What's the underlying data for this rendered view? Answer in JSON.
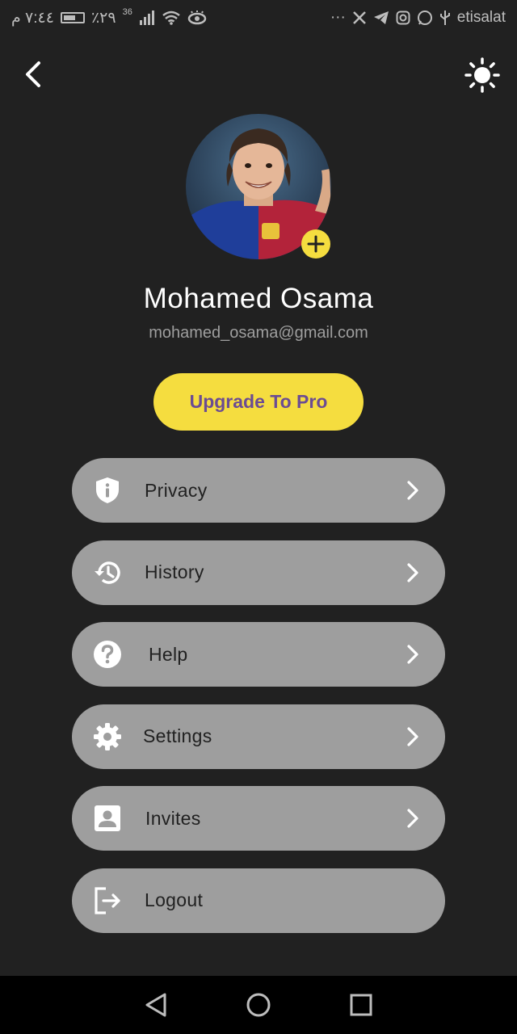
{
  "status_bar": {
    "time": "٧:٤٤ م",
    "battery_percent": "٪٢٩",
    "signal_label": "36",
    "carrier": "etisalat",
    "overflow": "···"
  },
  "header": {
    "back_icon": "chevron-left-icon",
    "theme_icon": "sun-icon"
  },
  "profile": {
    "name": "Mohamed Osama",
    "email": "mohamed_osama@gmail.com"
  },
  "upgrade_button": "Upgrade To Pro",
  "menu": [
    {
      "label": "Privacy",
      "icon": "shield-info-icon",
      "chevron": true
    },
    {
      "label": "History",
      "icon": "history-icon",
      "chevron": true
    },
    {
      "label": "Help",
      "icon": "help-icon",
      "chevron": true
    },
    {
      "label": "Settings",
      "icon": "gear-icon",
      "chevron": true
    },
    {
      "label": "Invites",
      "icon": "contact-icon",
      "chevron": true
    },
    {
      "label": "Logout",
      "icon": "logout-icon",
      "chevron": false
    }
  ],
  "colors": {
    "background": "#212121",
    "accent": "#f5dd3f",
    "menu_bg": "#9e9e9e",
    "upgrade_text": "#6b4c93"
  }
}
